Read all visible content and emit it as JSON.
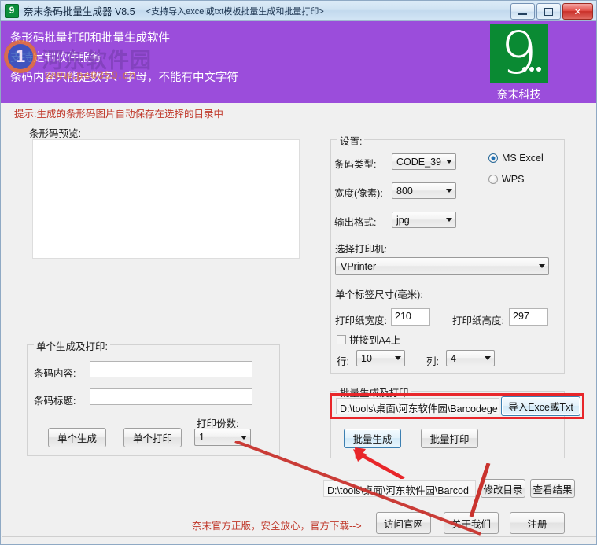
{
  "window": {
    "icon": "app-logo-icon",
    "title": "奈末条码批量生成器 V8.5",
    "subtitle": "<支持导入excel或txt模板批量生成和批量打印>",
    "minimize_label": "最小化",
    "maximize_label": "最大化",
    "close_label": "✕"
  },
  "banner": {
    "line1": "条形码批量打印和批量生成软件",
    "line2": "支持定制软件服务",
    "line3": "条码内容只能是数字、字母，不能有中文字符",
    "logo_digit": "9",
    "logo_caption": "奈末科技",
    "bg_color": "#9b4ddb",
    "logo_color": "#0a8a33"
  },
  "watermark": {
    "ring_text": "1",
    "text": "河东软件园",
    "url": "www.pc0359.cn"
  },
  "tip": {
    "text": "提示:生成的条形码图片自动保存在选择的目录中",
    "color": "#c0392b"
  },
  "preview": {
    "legend": "条形码预览:",
    "content": ""
  },
  "single": {
    "legend": "单个生成及打印:",
    "content_label": "条码内容:",
    "content_value": "",
    "title_label": "条码标题:",
    "title_value": "",
    "copies_label": "打印份数:",
    "copies_value": "1",
    "generate_button": "单个生成",
    "print_button": "单个打印"
  },
  "settings": {
    "legend": "设置:",
    "barcode_type_label": "条码类型:",
    "barcode_type_value": "CODE_39",
    "width_label": "宽度(像素):",
    "width_value": "800",
    "format_label": "输出格式:",
    "format_value": "jpg",
    "office_options": [
      {
        "label": "MS  Excel",
        "selected": true
      },
      {
        "label": "WPS",
        "selected": false
      }
    ],
    "printer_label": "选择打印机:",
    "printer_value": "VPrinter",
    "label_size_label": "单个标签尺寸(毫米):",
    "paper_width_label": "打印纸宽度:",
    "paper_width_value": "210",
    "paper_height_label": "打印纸高度:",
    "paper_height_value": "297",
    "tile_a4_label": "拼接到A4上",
    "tile_a4_checked": false,
    "rows_label": "行:",
    "rows_value": "10",
    "cols_label": "列:",
    "cols_value": "4"
  },
  "batch": {
    "legend": "批量生成及打印",
    "path_value": "D:\\tools\\桌面\\河东软件园\\Barcodege",
    "import_button": "导入Exce或Txt",
    "generate_button": "批量生成",
    "print_button": "批量打印",
    "highlight_color": "#e8262a"
  },
  "output": {
    "path_value": "D:\\tools\\桌面\\河东软件园\\Barcod",
    "change_dir_button": "修改目录",
    "view_result_button": "查看结果"
  },
  "footer": {
    "note": "奈末官方正版，安全放心，官方下载-->",
    "visit_site_button": "访问官网",
    "about_us_button": "关于我们",
    "register_button": "注册"
  }
}
